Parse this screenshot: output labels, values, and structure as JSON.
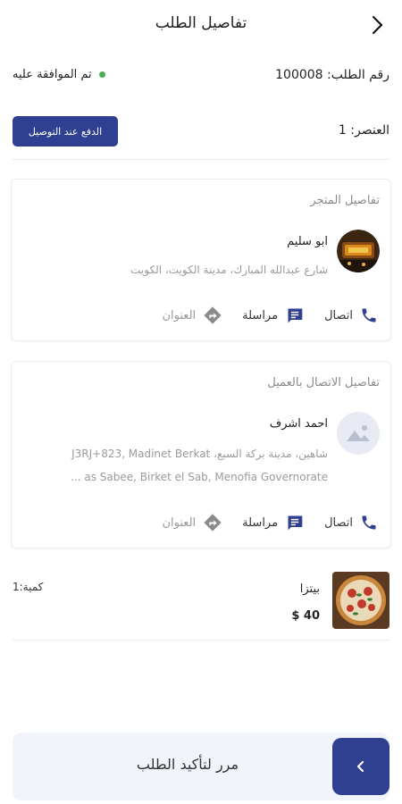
{
  "header": {
    "title": "تفاصيل الطلب",
    "back_icon": "chevron-right-icon"
  },
  "order": {
    "number_label": "رقم الطلب:",
    "number": "100008",
    "status_text": "تم الموافقة عليه",
    "status_color": "#4caf50",
    "items_label": "العنصر:",
    "items_count": "1",
    "payment_badge": "الدفع عند التوصيل"
  },
  "store_card": {
    "title": "تفاصيل المتجر",
    "name": "ابو سليم",
    "address": "شارع عبدالله المبارك، مدينة الكويت، الكويت",
    "actions": [
      {
        "label": "اتصال",
        "icon": "phone-icon"
      },
      {
        "label": "مراسلة",
        "icon": "chat-icon"
      },
      {
        "label": "العنوان",
        "icon": "directions-icon"
      }
    ]
  },
  "customer_card": {
    "title": "تفاصيل الاتصال بالعميل",
    "name": "احمد اشرف",
    "address_line1": "شاهين، مدينة بركة السبع، J3RJ+823, Madinet Berkat",
    "address_line2": "as Sabee, Birket el Sab, Menofia Governorate ...",
    "actions": [
      {
        "label": "اتصال",
        "icon": "phone-icon"
      },
      {
        "label": "مراسلة",
        "icon": "chat-icon"
      },
      {
        "label": "العنوان",
        "icon": "directions-icon"
      }
    ]
  },
  "product": {
    "name": "بيتزا",
    "price": "40 $",
    "quantity": "كمية:1"
  },
  "confirm_bar": {
    "label": "مرر لتأكيد الطلب",
    "button_icon": "chevron-left-icon"
  },
  "colors": {
    "primary": "#2f3f91",
    "accent_icon": "#2f3f91",
    "status_green": "#4caf50",
    "confirm_bg": "#f1f4fb"
  }
}
